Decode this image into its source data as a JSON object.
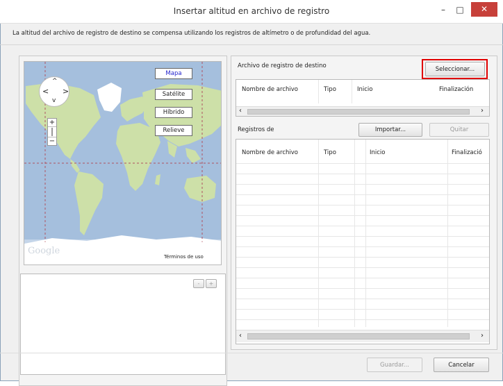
{
  "window": {
    "title": "Insertar altitud en archivo de registro",
    "minimize_glyph": "–",
    "maximize_glyph": "□",
    "close_glyph": "✕"
  },
  "description": "La altitud del archivo de registro de destino se compensa utilizando los registros de altímetro o de profundidad del agua.",
  "map": {
    "types": [
      "Mapa",
      "Satélite",
      "Híbrido",
      "Relieve"
    ],
    "logo": "Google",
    "terms": "Términos de uso",
    "zoom_in": "+",
    "zoom_out": "−",
    "pan": {
      "up": "^",
      "down": "v",
      "left": "<",
      "right": ">"
    }
  },
  "lower_left": {
    "minus": "-",
    "plus": "+"
  },
  "target": {
    "label": "Archivo de registro de destino",
    "select_button": "Seleccionar...",
    "columns": [
      "Nombre de archivo",
      "Tipo",
      "Inicio",
      "Finalización"
    ]
  },
  "logs": {
    "label": "Registros de",
    "import_button": "Importar...",
    "remove_button": "Quitar",
    "columns": [
      "Nombre de archivo",
      "Tipo",
      "Inicio",
      "Finalizació"
    ]
  },
  "scroll": {
    "left": "‹",
    "right": "›"
  },
  "footer": {
    "save_button": "Guardar...",
    "cancel_button": "Cancelar"
  },
  "colors": {
    "highlight": "#e00000",
    "selected_map_type": "#2222cc",
    "ocean": "#a5bfdd",
    "land": "#cde0a8",
    "close": "#c7403a"
  }
}
